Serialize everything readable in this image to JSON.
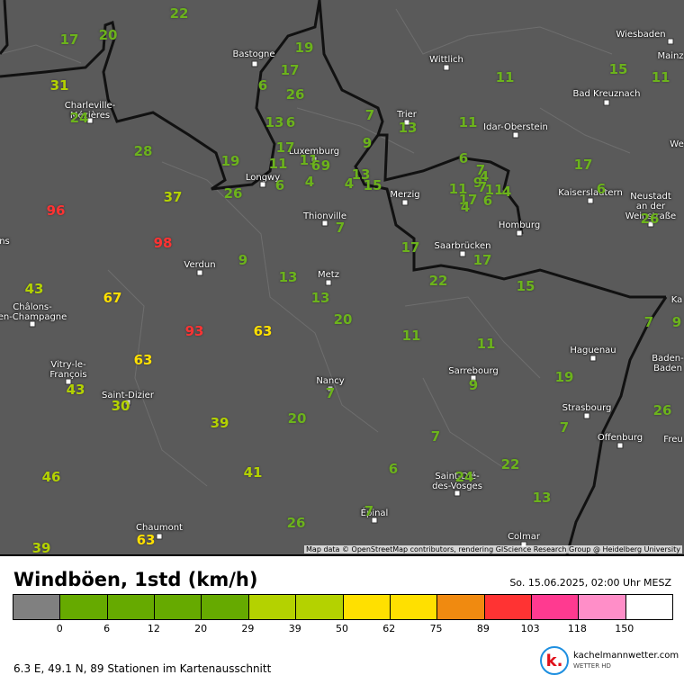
{
  "map": {
    "attribution": "Map data © OpenStreetMap contributors, rendering GIScience Research Group @ Heidelberg University",
    "cities": [
      "Bastogne",
      "Wiesbaden",
      "Mainz",
      "Wittlich",
      "Bad Kreuznach",
      "Trier",
      "Idar-Oberstein",
      "Charleville-\nMézières",
      "Luxemburg",
      "Longwy",
      "Merzig",
      "Thionville",
      "Saarbrücken",
      "Homburg",
      "Kaiserslautern",
      "Neustadt\nan der\nWeinstraße",
      "Verdun",
      "Metz",
      "Châlons-\nen-Champagne",
      "Vitry-le-\nFrançois",
      "Saint-Dizier",
      "Nancy",
      "Sarrebourg",
      "Haguenau",
      "Strasbourg",
      "Offenburg",
      "Baden-\nBaden",
      "Saint-Dié-\ndes-Vosges",
      "Épinal",
      "Colmar",
      "Chaumont",
      "Ka",
      "We",
      "Freu",
      "ns"
    ],
    "stations": [
      22,
      17,
      20,
      31,
      24,
      28,
      19,
      17,
      6,
      26,
      13,
      6,
      7,
      13,
      11,
      11,
      15,
      11,
      9,
      17,
      11,
      11,
      6,
      9,
      19,
      37,
      26,
      6,
      4,
      4,
      13,
      15,
      6,
      7,
      4,
      9,
      7,
      11,
      11,
      4,
      17,
      4,
      6,
      17,
      6,
      26,
      96,
      98,
      7,
      17,
      9,
      13,
      17,
      22,
      15,
      43,
      67,
      13,
      20,
      93,
      63,
      11,
      11,
      7,
      9,
      63,
      19,
      43,
      30,
      7,
      9,
      26,
      39,
      20,
      7,
      7,
      6,
      22,
      46,
      41,
      24,
      13,
      7,
      26,
      39,
      63
    ]
  },
  "legend": {
    "title": "Windböen, 1std (km/h)",
    "datetime": "So. 15.06.2025, 02:00 Uhr MESZ",
    "colors": [
      "#808080",
      "#66aa00",
      "#66aa00",
      "#66aa00",
      "#66aa00",
      "#b4d200",
      "#b4d200",
      "#ffe000",
      "#ffe000",
      "#f08a10",
      "#ff3333",
      "#ff3a90",
      "#ff8ec8",
      "#ffffff"
    ],
    "ticks": [
      "0",
      "6",
      "12",
      "20",
      "29",
      "39",
      "50",
      "62",
      "75",
      "89",
      "103",
      "118",
      "150"
    ]
  },
  "footer": {
    "info": "6.3 E, 49.1 N, 89 Stationen im Kartenausschnitt",
    "logo_mark": "k.",
    "brand": "kachelmannwetter.com",
    "brand_sub": "WETTER HD"
  }
}
